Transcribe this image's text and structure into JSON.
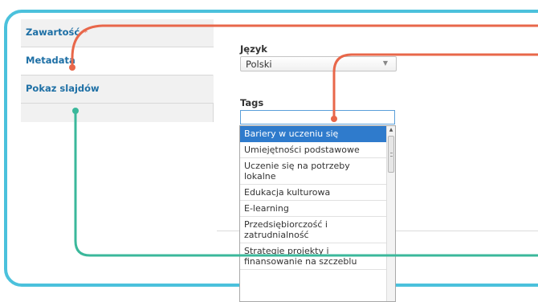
{
  "tabs": [
    {
      "label": "Zawartość",
      "required_mark": "*"
    },
    {
      "label": "Metadata"
    },
    {
      "label": "Pokaz slajdów"
    }
  ],
  "language": {
    "label": "Język",
    "value": "Polski"
  },
  "tags": {
    "label": "Tags",
    "input_value": "",
    "options": [
      "Bariery w uczeniu się",
      "Umiejętności podstawowe",
      "Uczenie się na potrzeby lokalne",
      "Edukacja kulturowa",
      "E-learning",
      "Przedsiębiorczość i zatrudnialność",
      "Strategie projekty i finansowanie na szczeblu"
    ],
    "selected_option": "Bariery w uczeniu się"
  },
  "colors": {
    "frame": "#4bc1dc",
    "callout_orange": "#e8674a",
    "callout_teal": "#3bb89b",
    "link": "#1d6fa5",
    "selected": "#2f7bcc"
  }
}
